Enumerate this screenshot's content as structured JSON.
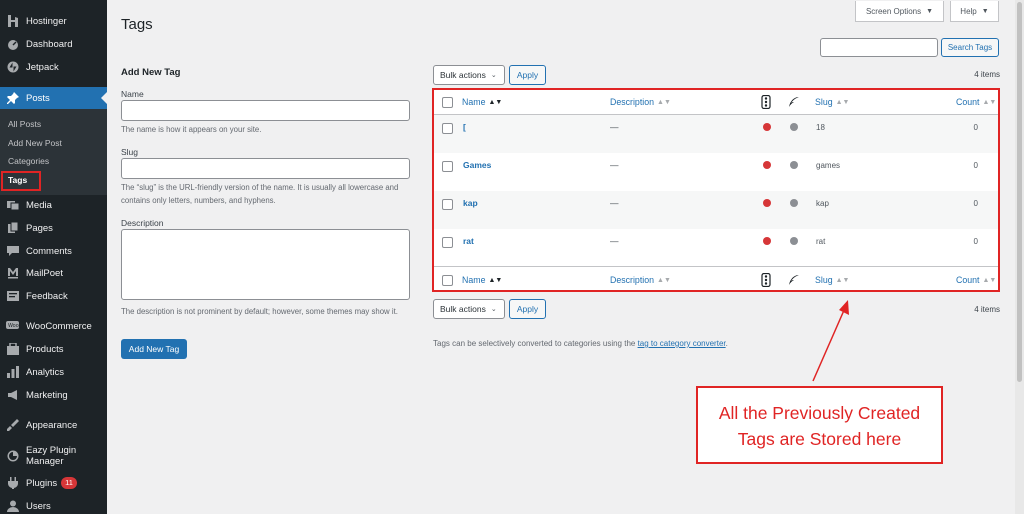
{
  "sidebar": {
    "brand": "Hostinger",
    "items": [
      {
        "label": "Dashboard"
      },
      {
        "label": "Jetpack"
      },
      {
        "label": "Posts"
      },
      {
        "label": "Media"
      },
      {
        "label": "Pages"
      },
      {
        "label": "Comments"
      },
      {
        "label": "MailPoet"
      },
      {
        "label": "Feedback"
      },
      {
        "label": "WooCommerce"
      },
      {
        "label": "Products"
      },
      {
        "label": "Analytics"
      },
      {
        "label": "Marketing"
      },
      {
        "label": "Appearance"
      },
      {
        "label": "Eazy Plugin Manager"
      },
      {
        "label": "Plugins",
        "badge": "11"
      },
      {
        "label": "Users"
      }
    ],
    "submenu": [
      "All Posts",
      "Add New Post",
      "Categories",
      "Tags"
    ]
  },
  "page": {
    "title": "Tags",
    "screen_options": "Screen Options",
    "help": "Help",
    "search_button": "Search Tags"
  },
  "form": {
    "heading": "Add New Tag",
    "name_label": "Name",
    "name_help": "The name is how it appears on your site.",
    "slug_label": "Slug",
    "slug_help": "The “slug” is the URL-friendly version of the name. It is usually all lowercase and contains only letters, numbers, and hyphens.",
    "description_label": "Description",
    "description_help": "The description is not prominent by default; however, some themes may show it.",
    "submit": "Add New Tag"
  },
  "list": {
    "bulk_actions": "Bulk actions",
    "apply": "Apply",
    "item_count": "4 items",
    "columns": {
      "name": "Name",
      "description": "Description",
      "slug": "Slug",
      "count": "Count"
    },
    "rows": [
      {
        "name": "[",
        "description": "—",
        "slug": "18",
        "count": "0"
      },
      {
        "name": "Games",
        "description": "—",
        "slug": "games",
        "count": "0"
      },
      {
        "name": "kap",
        "description": "—",
        "slug": "kap",
        "count": "0"
      },
      {
        "name": "rat",
        "description": "—",
        "slug": "rat",
        "count": "0"
      }
    ],
    "note_prefix": "Tags can be selectively converted to categories using the ",
    "note_link": "tag to category converter",
    "note_suffix": "."
  },
  "annotation": {
    "line1": "All the Previously Created",
    "line2": "Tags are Stored here"
  },
  "colors": {
    "accent": "#2271b1",
    "highlight": "#e02424",
    "sidebar": "#1d2327",
    "seo_red": "#d63638",
    "readability_gray": "#8c8f94"
  },
  "icons": [
    "hostinger-icon",
    "dashboard-icon",
    "jetpack-icon",
    "pin-icon",
    "media-icon",
    "pages-icon",
    "comments-icon",
    "mailpoet-icon",
    "feedback-icon",
    "woocommerce-icon",
    "products-icon",
    "analytics-icon",
    "marketing-icon",
    "appearance-icon",
    "plugin-manager-icon",
    "plugins-icon",
    "users-icon",
    "traffic-light-icon",
    "feather-icon"
  ]
}
